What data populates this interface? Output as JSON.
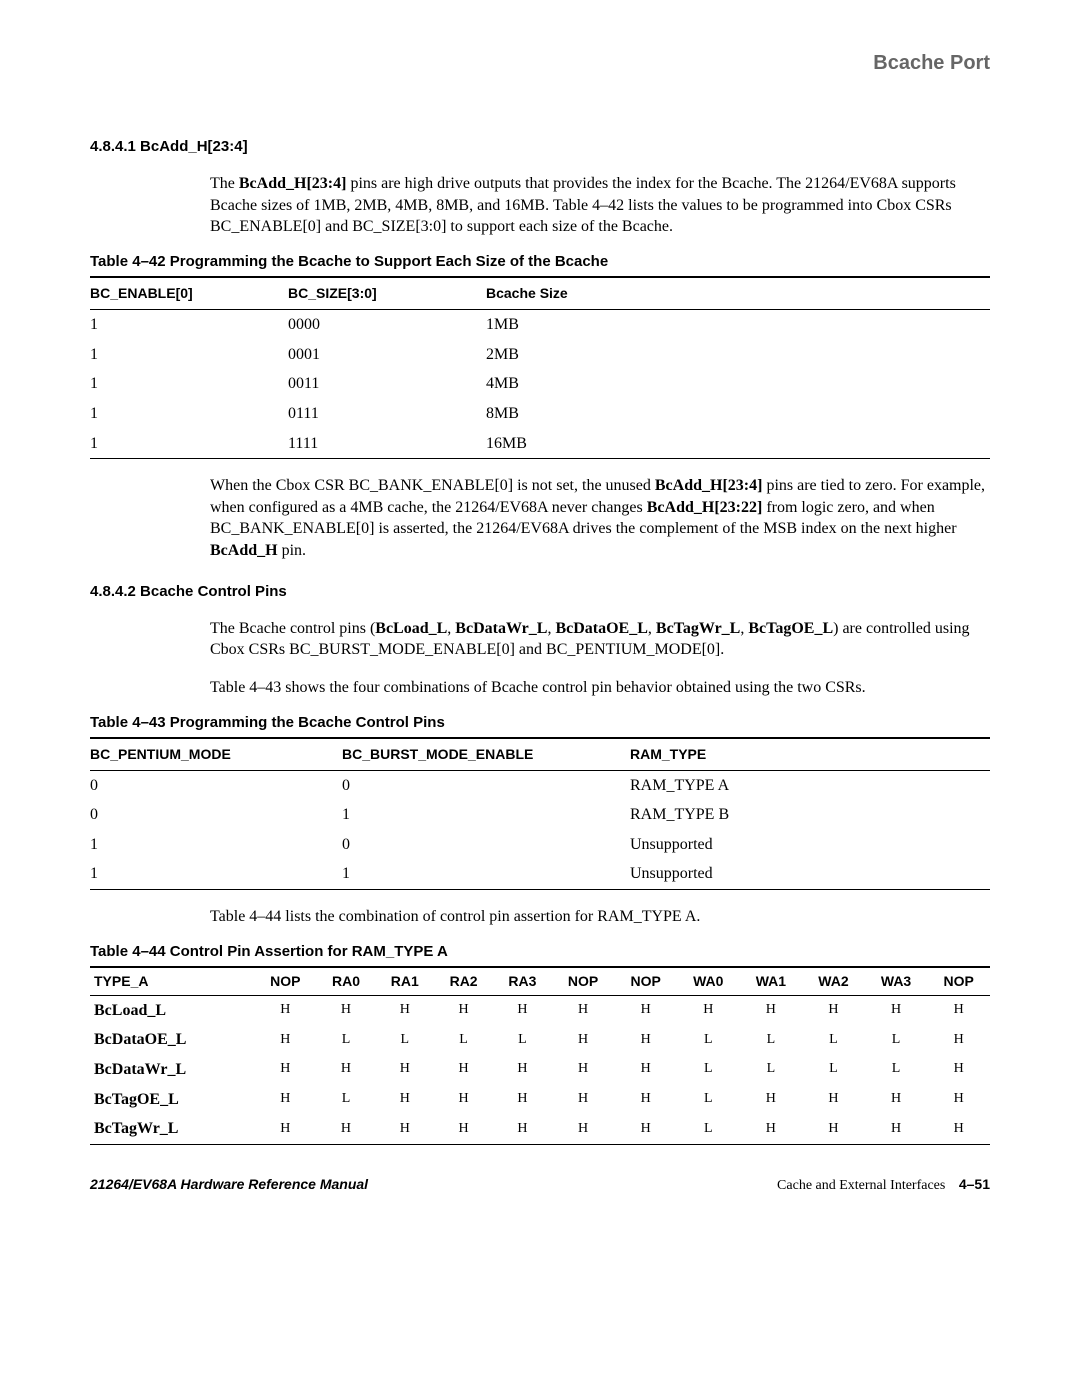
{
  "header": {
    "title": "Bcache Port"
  },
  "section1": {
    "heading": "4.8.4.1  BcAdd_H[23:4]",
    "para1_pre": "The ",
    "para1_b1": "BcAdd_H[23:4]",
    "para1_post": " pins are high drive outputs that provides the index for the Bcache. The 21264/EV68A supports Bcache sizes of 1MB, 2MB, 4MB, 8MB, and 16MB. Table 4–42 lists the values to be programmed into Cbox CSRs BC_ENABLE[0] and BC_SIZE[3:0] to support each size of the Bcache."
  },
  "table42": {
    "caption": "Table 4–42  Programming the Bcache to Support Each Size of the Bcache",
    "headers": [
      "BC_ENABLE[0]",
      "BC_SIZE[3:0]",
      "Bcache Size"
    ],
    "rows": [
      [
        "1",
        "0000",
        "1MB"
      ],
      [
        "1",
        "0001",
        "2MB"
      ],
      [
        "1",
        "0011",
        "4MB"
      ],
      [
        "1",
        "0111",
        "8MB"
      ],
      [
        "1",
        "1111",
        "16MB"
      ]
    ]
  },
  "section1b": {
    "p_pre": "When the Cbox CSR BC_BANK_ENABLE[0] is not set, the unused ",
    "p_b1": "BcAdd_H[23:4]",
    "p_mid1": " pins are tied to zero. For example, when configured as a 4MB cache, the 21264/EV68A never changes ",
    "p_b2": "BcAdd_H[23:22]",
    "p_mid2": " from logic zero, and when BC_BANK_ENABLE[0] is asserted, the 21264/EV68A drives the complement of the MSB index on the next higher ",
    "p_b3": "BcAdd_H",
    "p_post": " pin."
  },
  "section2": {
    "heading": "4.8.4.2  Bcache Control Pins",
    "p1_pre": "The Bcache control pins (",
    "p1_b1": "BcLoad_L",
    "p1_s1": ", ",
    "p1_b2": "BcDataWr_L",
    "p1_s2": ", ",
    "p1_b3": "BcDataOE_L",
    "p1_s3": ", ",
    "p1_b4": "BcTagWr_L",
    "p1_s4": ", ",
    "p1_b5": "BcTagOE_L",
    "p1_post": ") are controlled using Cbox CSRs BC_BURST_MODE_ENABLE[0] and BC_PENTIUM_MODE[0].",
    "p2": "Table 4–43 shows the four combinations of Bcache control pin behavior obtained using the two CSRs."
  },
  "table43": {
    "caption": "Table 4–43  Programming the Bcache Control Pins",
    "headers": [
      "BC_PENTIUM_MODE",
      "BC_BURST_MODE_ENABLE",
      "RAM_TYPE"
    ],
    "rows": [
      [
        "0",
        "0",
        "RAM_TYPE A"
      ],
      [
        "0",
        "1",
        "RAM_TYPE B"
      ],
      [
        "1",
        "0",
        "Unsupported"
      ],
      [
        "1",
        "1",
        "Unsupported"
      ]
    ]
  },
  "section2b": {
    "p": "Table 4–44 lists the combination of control pin assertion for RAM_TYPE A."
  },
  "table44": {
    "caption": "Table 4–44  Control Pin Assertion for RAM_TYPE A",
    "headers": [
      "TYPE_A",
      "NOP",
      "RA0",
      "RA1",
      "RA2",
      "RA3",
      "NOP",
      "NOP",
      "WA0",
      "WA1",
      "WA2",
      "WA3",
      "NOP"
    ],
    "rows": [
      [
        "BcLoad_L",
        "H",
        "H",
        "H",
        "H",
        "H",
        "H",
        "H",
        "H",
        "H",
        "H",
        "H",
        "H"
      ],
      [
        "BcDataOE_L",
        "H",
        "L",
        "L",
        "L",
        "L",
        "H",
        "H",
        "L",
        "L",
        "L",
        "L",
        "H"
      ],
      [
        "BcDataWr_L",
        "H",
        "H",
        "H",
        "H",
        "H",
        "H",
        "H",
        "L",
        "L",
        "L",
        "L",
        "H"
      ],
      [
        "BcTagOE_L",
        "H",
        "L",
        "H",
        "H",
        "H",
        "H",
        "H",
        "L",
        "H",
        "H",
        "H",
        "H"
      ],
      [
        "BcTagWr_L",
        "H",
        "H",
        "H",
        "H",
        "H",
        "H",
        "H",
        "L",
        "H",
        "H",
        "H",
        "H"
      ]
    ]
  },
  "footer": {
    "left": "21264/EV68A Hardware Reference Manual",
    "right_text": "Cache and External Interfaces",
    "page": "4–51"
  }
}
